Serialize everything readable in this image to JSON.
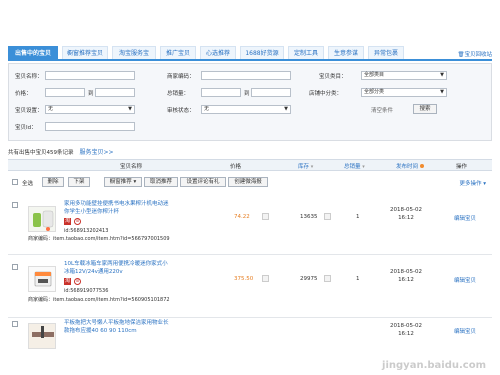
{
  "tabs": [
    {
      "label": "出售中的宝贝",
      "active": true
    },
    {
      "label": "橱窗推荐宝贝",
      "active": false
    },
    {
      "label": "淘宝服务宝",
      "active": false
    },
    {
      "label": "推广宝贝",
      "active": false
    },
    {
      "label": "心选推荐",
      "active": false
    },
    {
      "label": "1688好货源",
      "active": false
    },
    {
      "label": "定制工具",
      "active": false
    },
    {
      "label": "生意参谋",
      "active": false
    },
    {
      "label": "异常包裹",
      "active": false
    }
  ],
  "tab_right_label": "宝贝回收站",
  "filters": {
    "name_label": "宝贝名称：",
    "code_label": "商家编码：",
    "category_label": "宝贝类目：",
    "category_value": "全部类目",
    "price_label": "价格：",
    "price_to": "到",
    "sales_label": "总销量：",
    "sales_to": "到",
    "shop_category_label": "店铺中分类：",
    "shop_category_value": "全部分类",
    "settings_label": "宝贝设置：",
    "settings_value": "无",
    "review_label": "审核状态：",
    "review_value": "无",
    "id_label": "宝贝Id：",
    "clear_label": "清空条件",
    "search_label": "搜索"
  },
  "summary": {
    "text": "共有出售中宝贝459条记录",
    "service_link": "服务宝贝>>"
  },
  "table_header": {
    "name": "宝贝名称",
    "price": "价格",
    "stock": "库存",
    "sales": "总销量",
    "published": "发布时间",
    "action": "操作"
  },
  "actions": {
    "select_all": "全选",
    "delete": "删除",
    "delist": "下架",
    "showcase": "橱窗推荐",
    "cancel_recommend": "取消推荐",
    "set_review": "设置评论有礼",
    "create_flash": "创建微海报",
    "more": "更多操作"
  },
  "rows": [
    {
      "title": "家用多功能壁挂便携书电水果榨汁机电动迷你学生小型迷你榨汁杯",
      "tag1": "淘",
      "id": "id:568913202413",
      "code": "商家编码：item.taobao.com/item.htm?id=566797001509",
      "price": "74.22",
      "stock": "13635",
      "sales": "1",
      "date": "2018-05-02",
      "time": "16:12",
      "edit": "编辑宝贝"
    },
    {
      "title": "10L车载冰箱车家两用便携冷暖迷你家式小冰箱12V/24v通用220v",
      "tag1": "淘",
      "id": "id:568919077536",
      "code": "商家编码：item.taobao.com/item.htm?id=560905101872",
      "price": "375.50",
      "stock": "29975",
      "sales": "1",
      "date": "2018-05-02",
      "time": "16:12",
      "edit": "编辑宝贝"
    },
    {
      "title": "平板拖把大号懒人平板拖地保洁家用物业长款拖布应援40 60 90 110cm",
      "date": "2018-05-02",
      "time": "16:12",
      "edit": "编辑宝贝"
    }
  ],
  "watermark": "jingyan.baidu.com"
}
